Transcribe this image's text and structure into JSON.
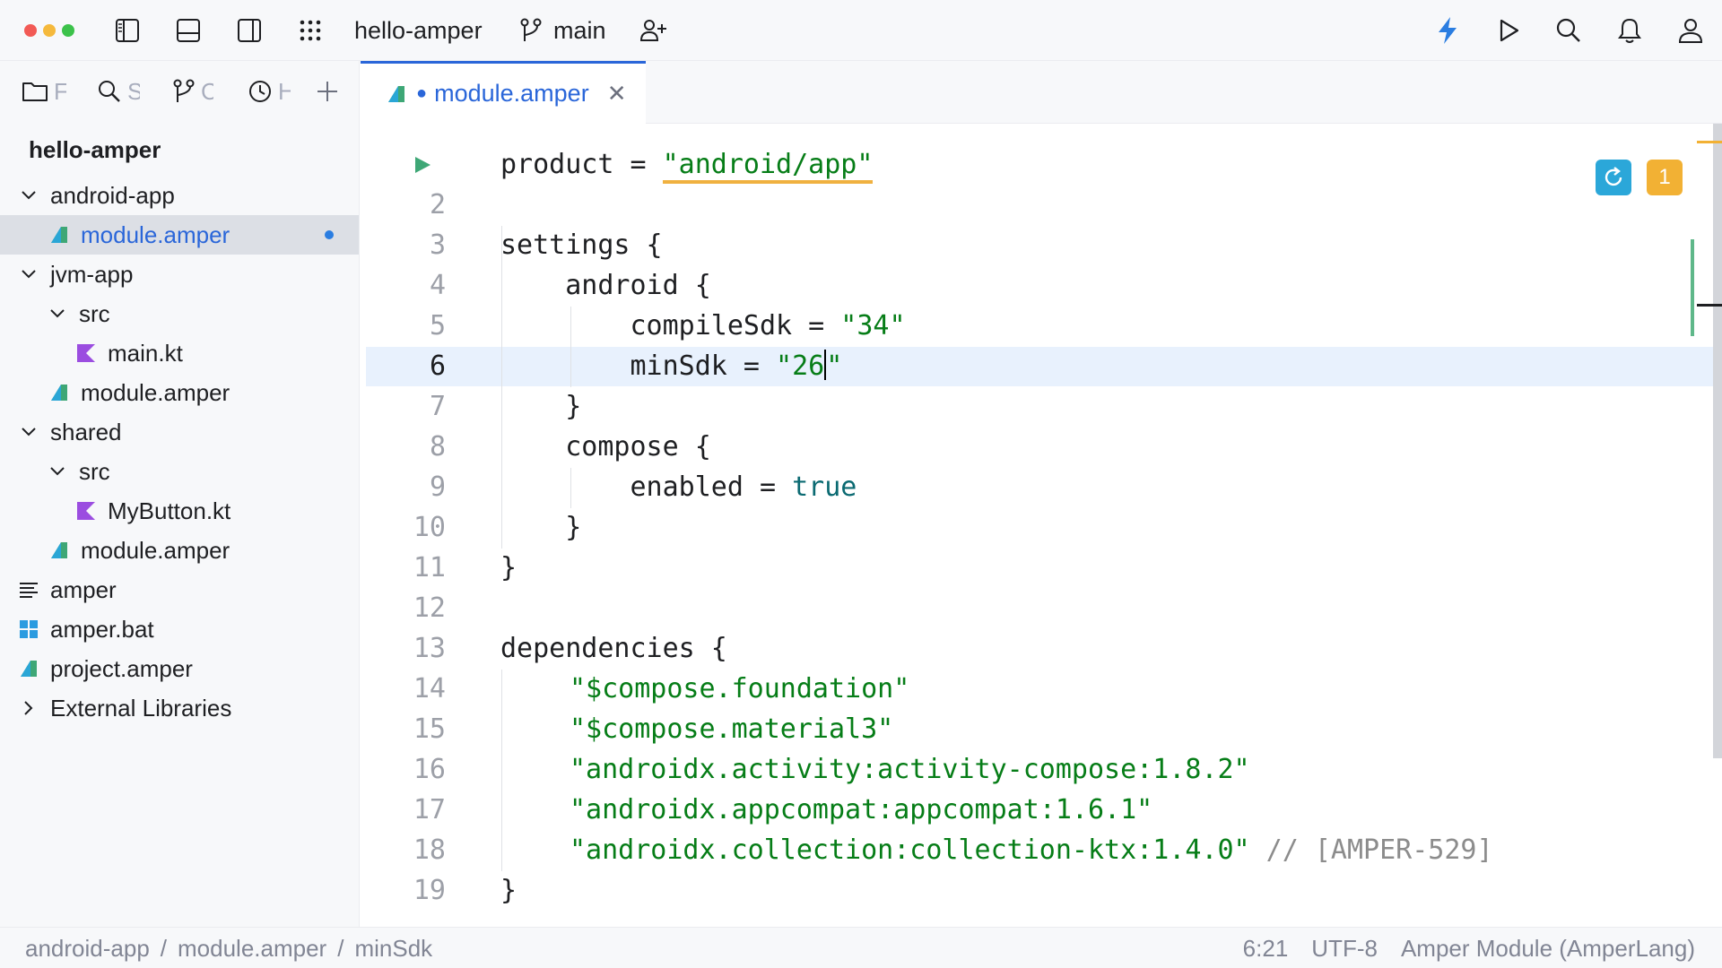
{
  "titlebar": {
    "project_name": "hello-amper",
    "branch": "main"
  },
  "sidebar": {
    "tabs": [
      {
        "icon": "folder-icon",
        "label": "F"
      },
      {
        "icon": "search-icon",
        "label": "S"
      },
      {
        "icon": "git-branch-icon",
        "label": "C"
      },
      {
        "icon": "clock-icon",
        "label": "H"
      }
    ],
    "tree_title": "hello-amper",
    "tree": [
      {
        "label": "android-app",
        "type": "folder",
        "expanded": true
      },
      {
        "label": "module.amper",
        "type": "amper",
        "selected": true,
        "modified": true
      },
      {
        "label": "jvm-app",
        "type": "folder",
        "expanded": true
      },
      {
        "label": "src",
        "type": "folder",
        "expanded": true
      },
      {
        "label": "main.kt",
        "type": "kotlin"
      },
      {
        "label": "module.amper",
        "type": "amper"
      },
      {
        "label": "shared",
        "type": "folder",
        "expanded": true
      },
      {
        "label": "src",
        "type": "folder",
        "expanded": true
      },
      {
        "label": "MyButton.kt",
        "type": "kotlin"
      },
      {
        "label": "module.amper",
        "type": "amper"
      },
      {
        "label": "amper",
        "type": "text-file"
      },
      {
        "label": "amper.bat",
        "type": "windows-file"
      },
      {
        "label": "project.amper",
        "type": "amper"
      },
      {
        "label": "External Libraries",
        "type": "libraries",
        "expanded": false
      }
    ]
  },
  "editor": {
    "tab_label": "module.amper",
    "warning_count": "1",
    "line_numbers": [
      "2",
      "3",
      "4",
      "5",
      "6",
      "7",
      "8",
      "9",
      "10",
      "11",
      "12",
      "13",
      "14",
      "15",
      "16",
      "17",
      "18",
      "19"
    ],
    "code": {
      "l1_key": "product = ",
      "l1_val": "\"android/app\"",
      "l3": "settings {",
      "l4": "    android {",
      "l5_key": "        compileSdk = ",
      "l5_val": "\"34\"",
      "l6_key": "        minSdk = ",
      "l6_val_a": "\"26",
      "l6_val_b": "\"",
      "l7": "    }",
      "l8": "    compose {",
      "l9_key": "        enabled = ",
      "l9_val": "true",
      "l10": "    }",
      "l11": "}",
      "l13": "dependencies {",
      "l14": "\"$compose.foundation\"",
      "l15": "\"$compose.material3\"",
      "l16": "\"androidx.activity:activity-compose:1.8.2\"",
      "l17": "\"androidx.appcompat:appcompat:1.6.1\"",
      "l18_val": "\"androidx.collection:collection-ktx:1.4.0\"",
      "l18_comment": " // [AMPER-529]",
      "l19": "}"
    }
  },
  "statusbar": {
    "breadcrumbs": [
      "android-app",
      "/",
      "module.amper",
      "/",
      "minSdk"
    ],
    "position": "6:21",
    "encoding": "UTF-8",
    "file_type": "Amper Module (AmperLang)"
  },
  "colors": {
    "accent": "#2a66d9",
    "string": "#067d17",
    "keyword": "#0b6a72",
    "warning": "#f2b134",
    "vcs_modified": "#5fb88a"
  }
}
